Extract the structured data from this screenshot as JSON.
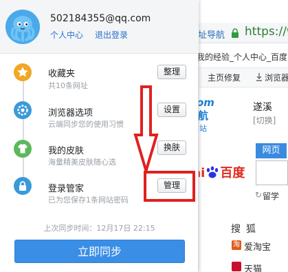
{
  "account": {
    "email": "502184355@qq.com",
    "personal_center": "个人中心",
    "logout": "退出登录"
  },
  "items": [
    {
      "title": "收藏夹",
      "subtitle": "共10条网址",
      "button": "整理",
      "icon": "star-icon",
      "color": "#f2a623"
    },
    {
      "title": "浏览器选项",
      "subtitle": "云端同步您的使用习惯",
      "button": "设置",
      "icon": "gear-icon",
      "color": "#3a9ad9"
    },
    {
      "title": "我的皮肤",
      "subtitle": "海量精美皮肤随心选",
      "button": "换肤",
      "icon": "shirt-icon",
      "color": "#5cb85c"
    },
    {
      "title": "登录管家",
      "subtitle": "已为您保存1条网站密码",
      "button": "管理",
      "icon": "lock-icon",
      "color": "#3a9ad9"
    }
  ],
  "sync": {
    "last_time": "上次同步时间：12月17日 22:15",
    "button": "立即同步"
  },
  "background_browser": {
    "nav_text": "址导航",
    "url_text": "https://w",
    "tab_title": "我的经验_个人中心_百度",
    "homepage_repair": "主页修复",
    "browser_text": "浏览器",
    "logo_om": "om",
    "logo_hang": "航",
    "logo_zhan": "站",
    "city": "遂溪",
    "switch": "[切换]",
    "search_tab": "网页",
    "baidu_text": "ai",
    "baidu_brand": "百度",
    "liuxue": "留学",
    "sohu": "搜狐",
    "taobao": "爱淘宝",
    "tianmao": "天猫"
  },
  "colors": {
    "accent": "#3a8ee6",
    "link": "#2a6fc9",
    "annotation": "#e02020"
  }
}
